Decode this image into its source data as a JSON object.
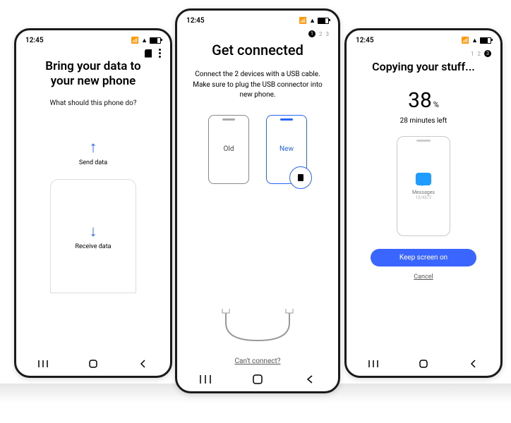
{
  "status_time": "12:45",
  "left": {
    "title_l1": "Bring your data to",
    "title_l2": "your new phone",
    "subtitle": "What should this phone do?",
    "send_label": "Send data",
    "receive_label": "Receive data"
  },
  "center": {
    "step_active": "1",
    "step_b": "2",
    "step_c": "3",
    "title": "Get connected",
    "desc": "Connect the 2 devices with a USB cable. Make sure to plug the USB connector into new phone.",
    "old_label": "Old",
    "new_label": "New",
    "cant": "Can't connect?"
  },
  "right": {
    "step_a": "1",
    "step_b": "2",
    "step_active": "3",
    "title": "Copying your stuff...",
    "percent": "38",
    "percent_sym": "%",
    "minutes": "28 minutes left",
    "msg_label": "Messages",
    "msg_count": "12/4372",
    "btn": "Keep screen on",
    "cancel": "Cancel"
  }
}
